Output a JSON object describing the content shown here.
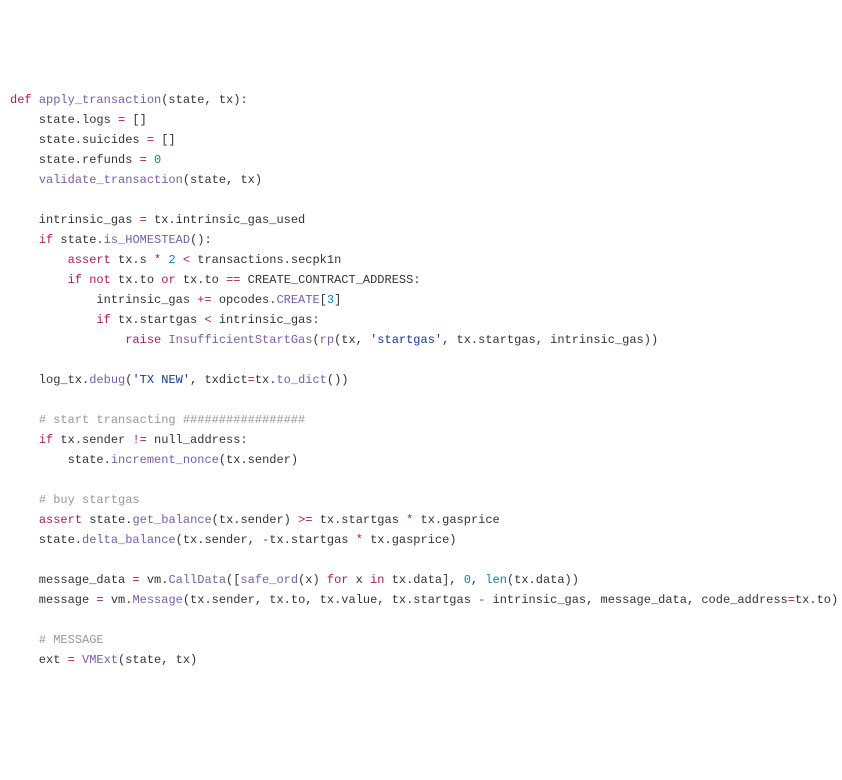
{
  "code": {
    "tokens": [
      {
        "cls": "k",
        "t": "def "
      },
      {
        "cls": "fn",
        "t": "apply_transaction"
      },
      {
        "cls": "t",
        "t": "(state, tx):\n"
      },
      {
        "cls": "t",
        "t": "    state.logs "
      },
      {
        "cls": "k",
        "t": "="
      },
      {
        "cls": "t",
        "t": " []\n"
      },
      {
        "cls": "t",
        "t": "    state.suicides "
      },
      {
        "cls": "k",
        "t": "="
      },
      {
        "cls": "t",
        "t": " []\n"
      },
      {
        "cls": "t",
        "t": "    state.refunds "
      },
      {
        "cls": "k",
        "t": "="
      },
      {
        "cls": "t",
        "t": " "
      },
      {
        "cls": "n",
        "t": "0"
      },
      {
        "cls": "t",
        "t": "\n"
      },
      {
        "cls": "t",
        "t": "    "
      },
      {
        "cls": "fn",
        "t": "validate_transaction"
      },
      {
        "cls": "t",
        "t": "(state, tx)\n"
      },
      {
        "cls": "t",
        "t": "\n"
      },
      {
        "cls": "t",
        "t": "    intrinsic_gas "
      },
      {
        "cls": "k",
        "t": "="
      },
      {
        "cls": "t",
        "t": " tx.intrinsic_gas_used\n"
      },
      {
        "cls": "t",
        "t": "    "
      },
      {
        "cls": "k",
        "t": "if"
      },
      {
        "cls": "t",
        "t": " state."
      },
      {
        "cls": "fn",
        "t": "is_HOMESTEAD"
      },
      {
        "cls": "t",
        "t": "():\n"
      },
      {
        "cls": "t",
        "t": "        "
      },
      {
        "cls": "k",
        "t": "assert"
      },
      {
        "cls": "t",
        "t": " tx.s "
      },
      {
        "cls": "k",
        "t": "*"
      },
      {
        "cls": "t",
        "t": " "
      },
      {
        "cls": "n",
        "t": "2"
      },
      {
        "cls": "t",
        "t": " "
      },
      {
        "cls": "k",
        "t": "<"
      },
      {
        "cls": "t",
        "t": " transactions.secpk1n\n"
      },
      {
        "cls": "t",
        "t": "        "
      },
      {
        "cls": "k",
        "t": "if"
      },
      {
        "cls": "t",
        "t": " "
      },
      {
        "cls": "k",
        "t": "not"
      },
      {
        "cls": "t",
        "t": " tx.to "
      },
      {
        "cls": "k",
        "t": "or"
      },
      {
        "cls": "t",
        "t": " tx.to "
      },
      {
        "cls": "k",
        "t": "=="
      },
      {
        "cls": "t",
        "t": " CREATE_CONTRACT_ADDRESS:\n"
      },
      {
        "cls": "t",
        "t": "            intrinsic_gas "
      },
      {
        "cls": "k",
        "t": "+="
      },
      {
        "cls": "t",
        "t": " opcodes."
      },
      {
        "cls": "fn",
        "t": "CREATE"
      },
      {
        "cls": "t",
        "t": "["
      },
      {
        "cls": "n",
        "t": "3"
      },
      {
        "cls": "t",
        "t": "]\n"
      },
      {
        "cls": "t",
        "t": "            "
      },
      {
        "cls": "k",
        "t": "if"
      },
      {
        "cls": "t",
        "t": " tx.startgas "
      },
      {
        "cls": "k",
        "t": "<"
      },
      {
        "cls": "t",
        "t": " intrinsic_gas:\n"
      },
      {
        "cls": "t",
        "t": "                "
      },
      {
        "cls": "k",
        "t": "raise"
      },
      {
        "cls": "t",
        "t": " "
      },
      {
        "cls": "fn",
        "t": "InsufficientStartGas"
      },
      {
        "cls": "t",
        "t": "("
      },
      {
        "cls": "fn",
        "t": "rp"
      },
      {
        "cls": "t",
        "t": "(tx, "
      },
      {
        "cls": "s",
        "t": "'startgas'"
      },
      {
        "cls": "t",
        "t": ", tx.startgas, intrinsic_gas))\n"
      },
      {
        "cls": "t",
        "t": "\n"
      },
      {
        "cls": "t",
        "t": "    log_tx."
      },
      {
        "cls": "fn",
        "t": "debug"
      },
      {
        "cls": "t",
        "t": "("
      },
      {
        "cls": "s",
        "t": "'TX NEW'"
      },
      {
        "cls": "t",
        "t": ", txdict"
      },
      {
        "cls": "k",
        "t": "="
      },
      {
        "cls": "t",
        "t": "tx."
      },
      {
        "cls": "fn",
        "t": "to_dict"
      },
      {
        "cls": "t",
        "t": "())\n"
      },
      {
        "cls": "t",
        "t": "\n"
      },
      {
        "cls": "t",
        "t": "    "
      },
      {
        "cls": "c",
        "t": "# start transacting #################"
      },
      {
        "cls": "t",
        "t": "\n"
      },
      {
        "cls": "t",
        "t": "    "
      },
      {
        "cls": "k",
        "t": "if"
      },
      {
        "cls": "t",
        "t": " tx.sender "
      },
      {
        "cls": "k",
        "t": "!="
      },
      {
        "cls": "t",
        "t": " null_address:\n"
      },
      {
        "cls": "t",
        "t": "        state."
      },
      {
        "cls": "fn",
        "t": "increment_nonce"
      },
      {
        "cls": "t",
        "t": "(tx.sender)\n"
      },
      {
        "cls": "t",
        "t": "\n"
      },
      {
        "cls": "t",
        "t": "    "
      },
      {
        "cls": "c",
        "t": "# buy startgas"
      },
      {
        "cls": "t",
        "t": "\n"
      },
      {
        "cls": "t",
        "t": "    "
      },
      {
        "cls": "k",
        "t": "assert"
      },
      {
        "cls": "t",
        "t": " state."
      },
      {
        "cls": "fn",
        "t": "get_balance"
      },
      {
        "cls": "t",
        "t": "(tx.sender) "
      },
      {
        "cls": "k",
        "t": ">="
      },
      {
        "cls": "t",
        "t": " tx.startgas "
      },
      {
        "cls": "k",
        "t": "*"
      },
      {
        "cls": "t",
        "t": " tx.gasprice\n"
      },
      {
        "cls": "t",
        "t": "    state."
      },
      {
        "cls": "fn",
        "t": "delta_balance"
      },
      {
        "cls": "t",
        "t": "(tx.sender, "
      },
      {
        "cls": "k",
        "t": "-"
      },
      {
        "cls": "t",
        "t": "tx.startgas "
      },
      {
        "cls": "k",
        "t": "*"
      },
      {
        "cls": "t",
        "t": " tx.gasprice)\n"
      },
      {
        "cls": "t",
        "t": "\n"
      },
      {
        "cls": "t",
        "t": "    message_data "
      },
      {
        "cls": "k",
        "t": "="
      },
      {
        "cls": "t",
        "t": " vm."
      },
      {
        "cls": "fn",
        "t": "CallData"
      },
      {
        "cls": "t",
        "t": "(["
      },
      {
        "cls": "fn",
        "t": "safe_ord"
      },
      {
        "cls": "t",
        "t": "(x) "
      },
      {
        "cls": "k",
        "t": "for"
      },
      {
        "cls": "t",
        "t": " x "
      },
      {
        "cls": "k",
        "t": "in"
      },
      {
        "cls": "t",
        "t": " tx.data], "
      },
      {
        "cls": "n",
        "t": "0"
      },
      {
        "cls": "t",
        "t": ", "
      },
      {
        "cls": "n",
        "t": "len"
      },
      {
        "cls": "t",
        "t": "(tx.data))\n"
      },
      {
        "cls": "t",
        "t": "    message "
      },
      {
        "cls": "k",
        "t": "="
      },
      {
        "cls": "t",
        "t": " vm."
      },
      {
        "cls": "fn",
        "t": "Message"
      },
      {
        "cls": "t",
        "t": "(tx.sender, tx.to, tx.value, tx.startgas "
      },
      {
        "cls": "k",
        "t": "-"
      },
      {
        "cls": "t",
        "t": " intrinsic_gas, message_data, code_address"
      },
      {
        "cls": "k",
        "t": "="
      },
      {
        "cls": "t",
        "t": "tx.to)\n"
      },
      {
        "cls": "t",
        "t": "\n"
      },
      {
        "cls": "t",
        "t": "    "
      },
      {
        "cls": "c",
        "t": "# MESSAGE"
      },
      {
        "cls": "t",
        "t": "\n"
      },
      {
        "cls": "t",
        "t": "    ext "
      },
      {
        "cls": "k",
        "t": "="
      },
      {
        "cls": "t",
        "t": " "
      },
      {
        "cls": "fn",
        "t": "VMExt"
      },
      {
        "cls": "t",
        "t": "(state, tx)\n"
      }
    ]
  }
}
